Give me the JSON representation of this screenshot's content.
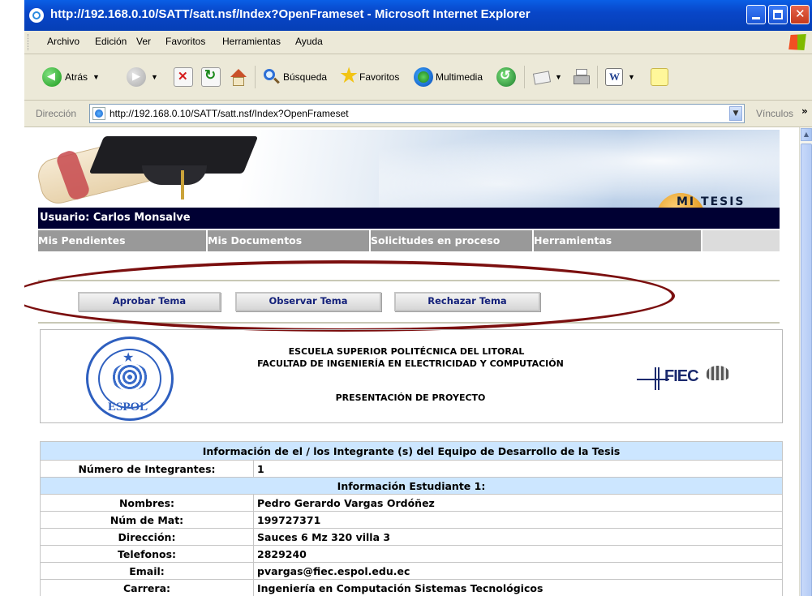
{
  "window": {
    "title": "http://192.168.0.10/SATT/satt.nsf/Index?OpenFrameset - Microsoft Internet Explorer"
  },
  "menu": {
    "items": [
      "Archivo",
      "Edición",
      "Ver",
      "Favoritos",
      "Herramientas",
      "Ayuda"
    ]
  },
  "toolbar": {
    "back_label": "Atrás",
    "search_label": "Búsqueda",
    "favorites_label": "Favoritos",
    "multimedia_label": "Multimedia"
  },
  "address": {
    "label": "Dirección",
    "url": "http://192.168.0.10/SATT/satt.nsf/Index?OpenFrameset",
    "links_label": "Vínculos"
  },
  "banner": {
    "brand": "MI TESIS"
  },
  "user": {
    "label": "Usuario: Carlos Monsalve"
  },
  "nav": {
    "items": [
      "Mis Pendientes",
      "Mis Documentos",
      "Solicitudes en proceso",
      "Herramientas"
    ]
  },
  "actions": {
    "approve": "Aprobar Tema",
    "observe": "Observar Tema",
    "reject": "Rechazar Tema"
  },
  "header": {
    "school": "ESCUELA SUPERIOR POLITÉCNICA DEL LITORAL",
    "faculty": "FACULTAD DE INGENIERÍA EN ELECTRICIDAD Y COMPUTACIÓN",
    "doc_title": "PRESENTACIÓN DE PROYECTO",
    "seal_text": "ESPOL",
    "seal_ring_text": "ESCUELA SUPERIOR POLITÉCNICA DEL LITORAL",
    "fiec_logo": "FIEC"
  },
  "team": {
    "section_title": "Información de el / los Integrante (s) del Equipo de Desarrollo de la Tesis",
    "count_label": "Número de Integrantes:",
    "count_value": "1",
    "student_title": "Información Estudiante 1:",
    "fields": [
      {
        "label": "Nombres:",
        "value": "Pedro Gerardo Vargas Ordóñez"
      },
      {
        "label": "Núm de Mat:",
        "value": "199727371"
      },
      {
        "label": "Dirección:",
        "value": "Sauces 6 Mz 320 villa 3"
      },
      {
        "label": "Telefonos:",
        "value": "2829240"
      },
      {
        "label": "Email:",
        "value": "pvargas@fiec.espol.edu.ec"
      },
      {
        "label": "Carrera:",
        "value": "Ingeniería en Computación Sistemas Tecnológicos"
      }
    ]
  },
  "colors": {
    "titlebar": "#0846c8",
    "userbar": "#000033",
    "nav": "#999999",
    "table_header": "#cce6ff",
    "annotation_ellipse": "#7b0f0f",
    "button_text": "#14217a"
  }
}
